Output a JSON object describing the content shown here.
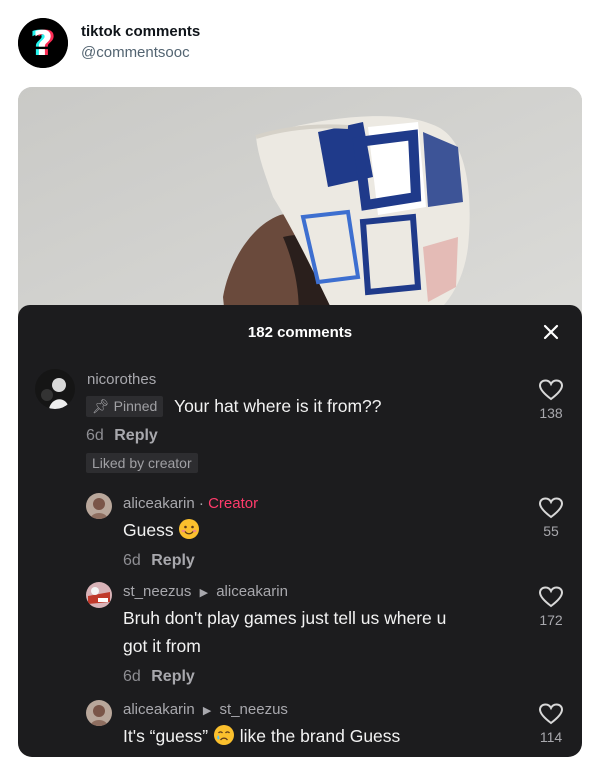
{
  "author": {
    "name": "tiktok comments",
    "handle": "@commentsooc"
  },
  "sheet": {
    "title": "182 comments"
  },
  "comments": [
    {
      "username": "nicorothes",
      "pinned_label": "Pinned",
      "text": "Your hat where is it from??",
      "age": "6d",
      "reply_label": "Reply",
      "liked_by_creator": "Liked by creator",
      "likes": "138"
    },
    {
      "username": "aliceakarin",
      "separator": "·",
      "creator_label": "Creator",
      "text": "Guess",
      "age": "6d",
      "reply_label": "Reply",
      "likes": "55"
    },
    {
      "username": "st_neezus",
      "reply_to": "aliceakarin",
      "text_line1": "Bruh don't play games just tell us where u",
      "text_line2": "got it from",
      "age": "6d",
      "reply_label": "Reply",
      "likes": "172"
    },
    {
      "username": "aliceakarin",
      "reply_to": "st_neezus",
      "text_before": "It's “guess”",
      "text_after": "like the brand Guess",
      "likes": "114"
    }
  ]
}
